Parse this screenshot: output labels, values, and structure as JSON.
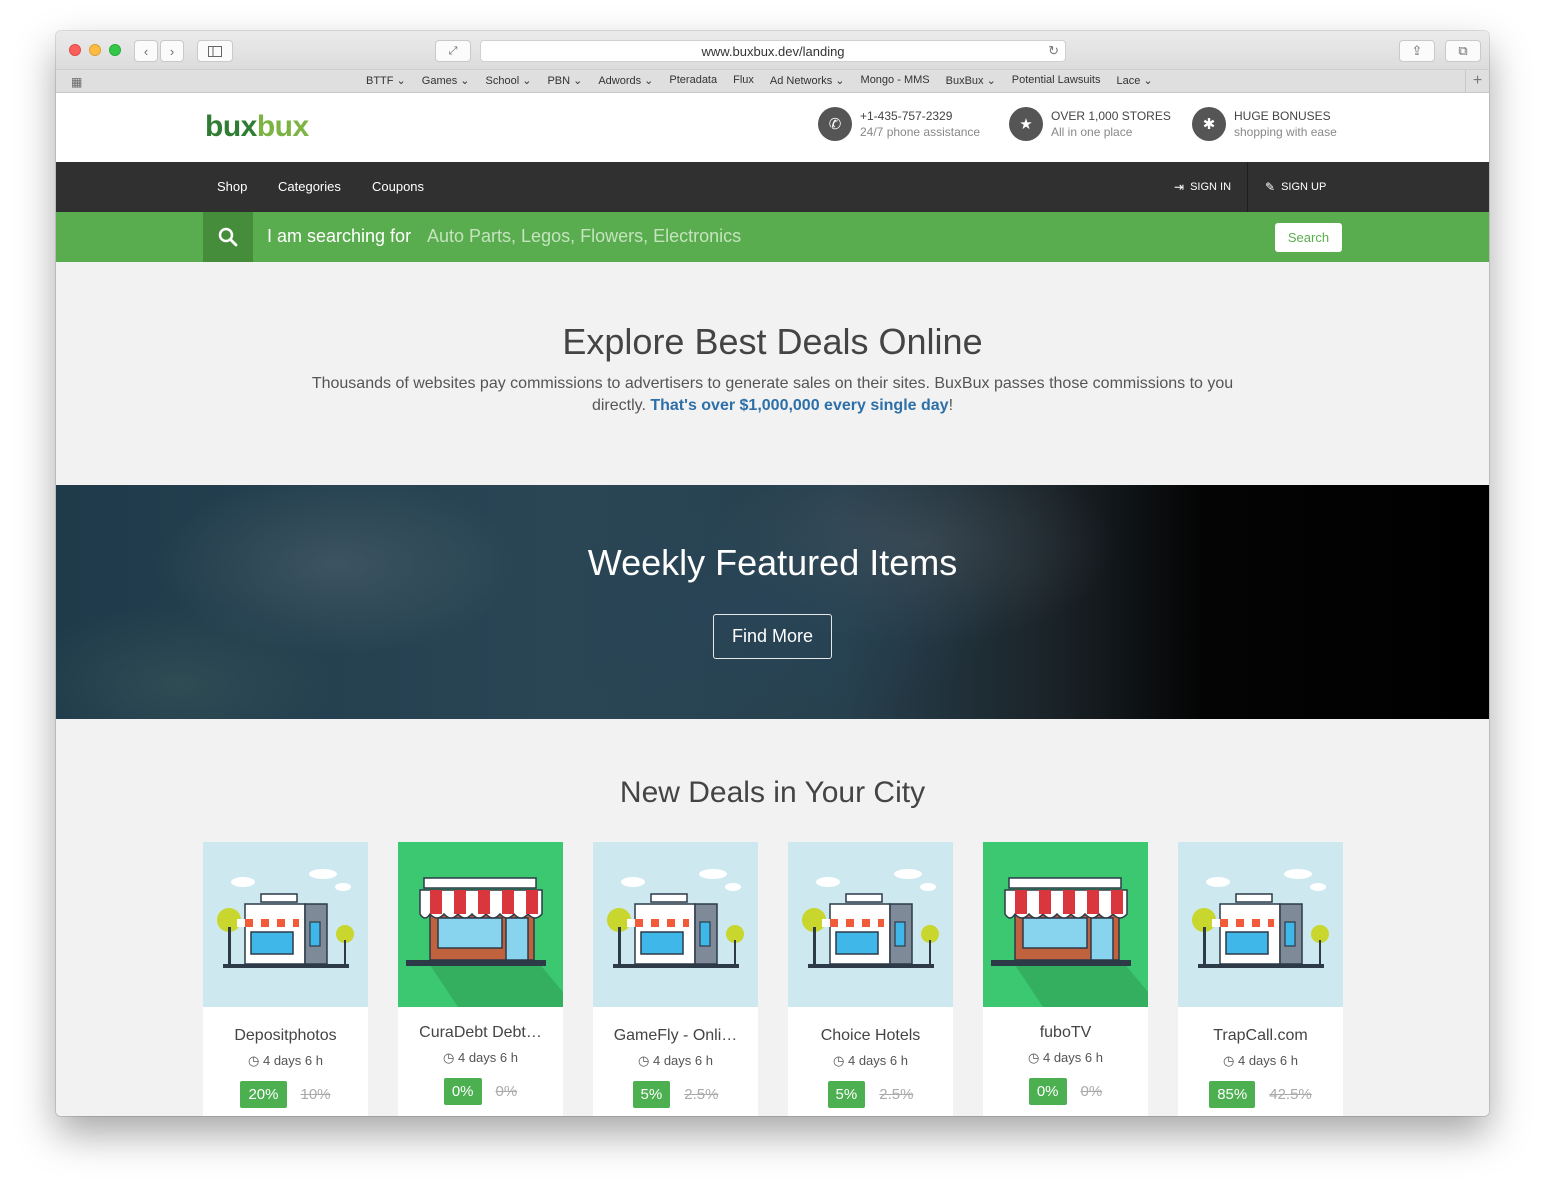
{
  "browser": {
    "url": "www.buxbux.dev/landing",
    "bookmarks": [
      "BTTF ⌄",
      "Games ⌄",
      "School ⌄",
      "PBN ⌄",
      "Adwords ⌄",
      "Pteradata",
      "Flux",
      "Ad Networks ⌄",
      "Mongo - MMS",
      "BuxBux ⌄",
      "Potential Lawsuits",
      "Lace ⌄"
    ]
  },
  "header": {
    "logo_part1": "bux",
    "logo_part2": "bux",
    "info": [
      {
        "icon": "phone-icon",
        "title": "+1-435-757-2329",
        "sub": "24/7 phone assistance"
      },
      {
        "icon": "star-icon",
        "title": "OVER 1,000 STORES",
        "sub": "All in one place"
      },
      {
        "icon": "asterisk-icon",
        "title": "HUGE BONUSES",
        "sub": "shopping with ease"
      }
    ]
  },
  "nav": {
    "items": [
      "Shop",
      "Categories",
      "Coupons"
    ],
    "sign_in": "SIGN IN",
    "sign_up": "SIGN UP"
  },
  "search": {
    "label": "I am searching for",
    "placeholder": "Auto Parts, Legos, Flowers, Electronics",
    "button": "Search"
  },
  "explore": {
    "title": "Explore Best Deals Online",
    "text": "Thousands of websites pay commissions to advertisers to generate sales on their sites. BuxBux passes those commissions to you directly. ",
    "highlight": "That's over $1,000,000 every single day",
    "end": "!"
  },
  "featured": {
    "title": "Weekly Featured Items",
    "button": "Find More"
  },
  "new_deals": {
    "title": "New Deals in Your City",
    "cards": [
      {
        "name": "Depositphotos",
        "time": "4 days 6 h",
        "rate": "20%",
        "old_rate": "10%",
        "style": "blue"
      },
      {
        "name": "CuraDebt Debt…",
        "time": "4 days 6 h",
        "rate": "0%",
        "old_rate": "0%",
        "style": "green"
      },
      {
        "name": "GameFly - Onli…",
        "time": "4 days 6 h",
        "rate": "5%",
        "old_rate": "2.5%",
        "style": "blue"
      },
      {
        "name": "Choice Hotels",
        "time": "4 days 6 h",
        "rate": "5%",
        "old_rate": "2.5%",
        "style": "blue"
      },
      {
        "name": "fuboTV",
        "time": "4 days 6 h",
        "rate": "0%",
        "old_rate": "0%",
        "style": "green"
      },
      {
        "name": "TrapCall.com",
        "time": "4 days 6 h",
        "rate": "85%",
        "old_rate": "42.5%",
        "style": "blue"
      }
    ]
  }
}
